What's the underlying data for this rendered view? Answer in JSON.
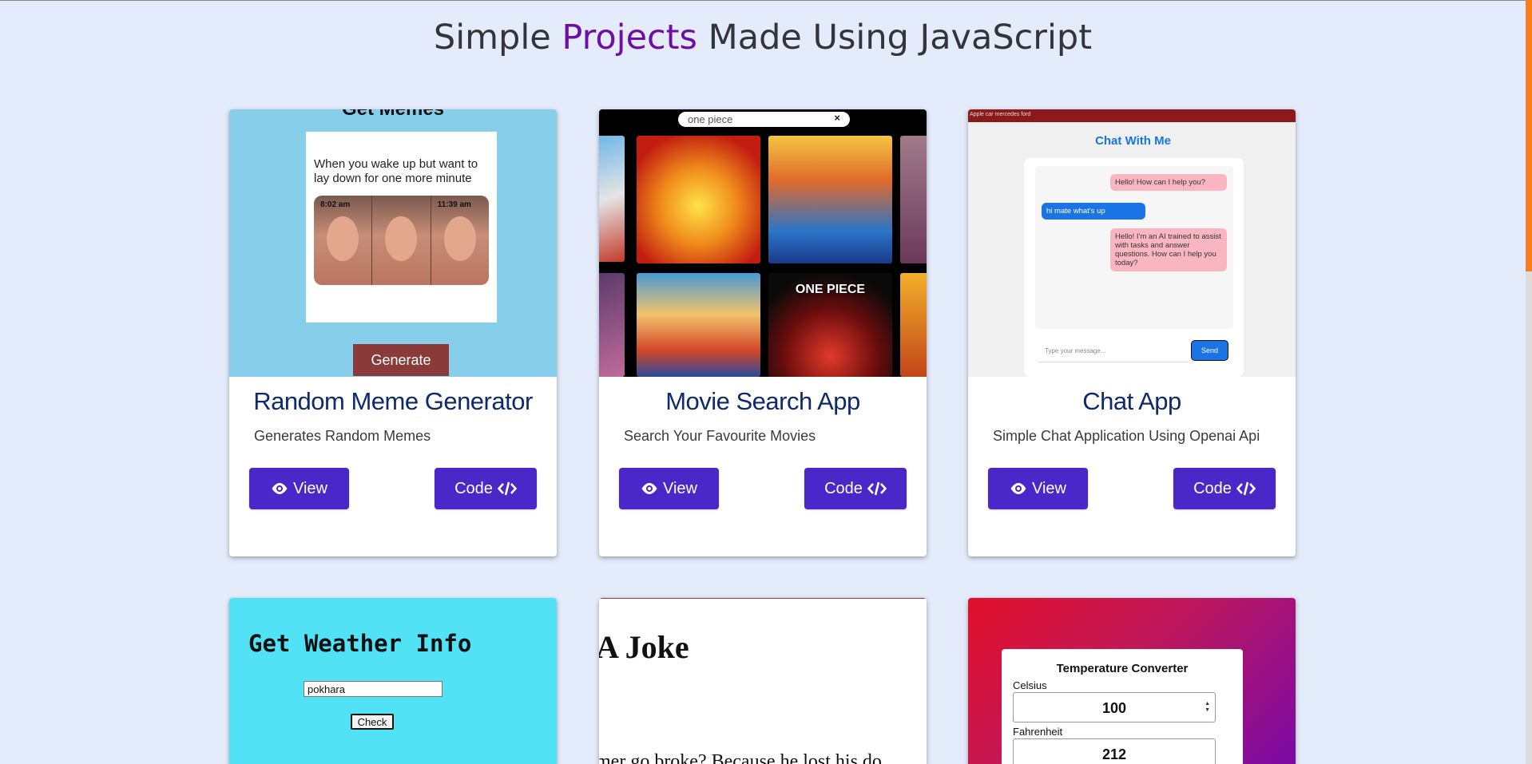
{
  "header": {
    "title_pre": "Simple ",
    "title_highlight": "Projects",
    "title_post": " Made Using JavaScript"
  },
  "colors": {
    "accent": "#6d0fa6",
    "button": "#4a27c9",
    "card_title": "#0e2a6b",
    "background": "#e4ebfb"
  },
  "buttons": {
    "view_label": "View",
    "code_label": "Code"
  },
  "icons": {
    "view": "eye-icon",
    "code": "code-icon"
  },
  "cards": [
    {
      "title": "Random Meme Generator",
      "description": "Generates Random Memes",
      "preview": {
        "heading": "Get Memes",
        "caption": "When you wake up but want to lay down for one more minute",
        "times": [
          "8:02 am",
          "11:39 am"
        ],
        "button": "Generate"
      }
    },
    {
      "title": "Movie Search App",
      "description": "Search Your Favourite Movies",
      "preview": {
        "search_value": "one piece",
        "clear": "×",
        "poster_label": "ONE PIECE"
      }
    },
    {
      "title": "Chat App",
      "description": "Simple Chat Application Using Openai Api",
      "preview": {
        "bar_text": "Apple car mercedes ford",
        "heading": "Chat With Me",
        "messages": [
          "Hello! How can I help you?",
          "hi mate what's up",
          "Hello! I'm an AI trained to assist with tasks and answer questions. How can I help you today?"
        ],
        "input_placeholder": "Type your message...",
        "send": "Send"
      }
    },
    {
      "preview": {
        "heading": "Get Weather Info",
        "input_value": "pokhara",
        "button": "Check"
      }
    },
    {
      "preview": {
        "heading": "A Joke",
        "text": "mer go broke? Because he lost his do"
      }
    },
    {
      "preview": {
        "heading": "Temperature Converter",
        "celsius_label": "Celsius",
        "celsius_value": "100",
        "fahrenheit_label": "Fahrenheit",
        "fahrenheit_value": "212"
      }
    }
  ]
}
